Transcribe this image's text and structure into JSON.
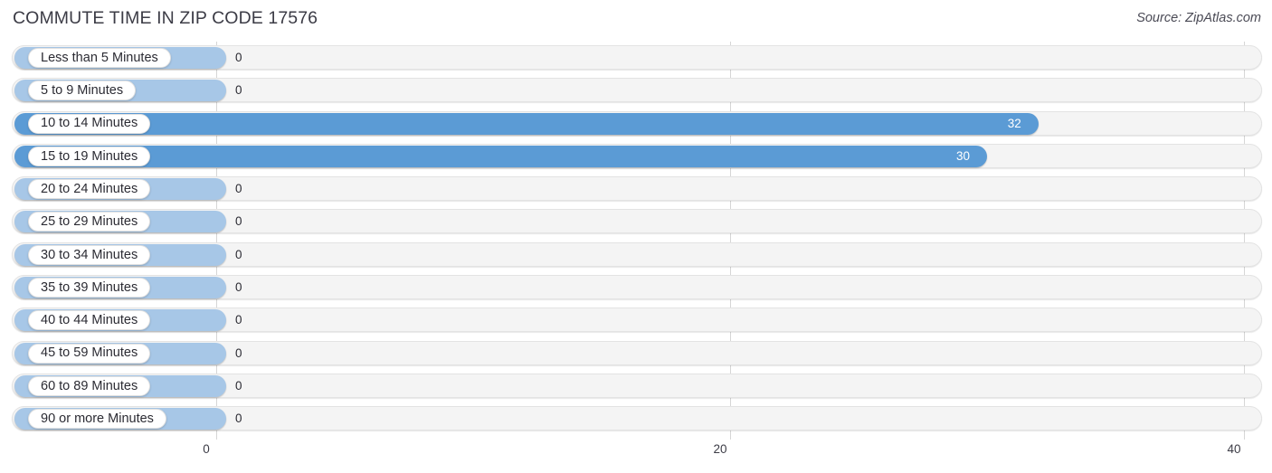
{
  "header": {
    "title": "COMMUTE TIME IN ZIP CODE 17576",
    "source": "Source: ZipAtlas.com"
  },
  "colors": {
    "bar_filled": "#5b9bd5",
    "bar_zero": "#a7c7e7",
    "track": "#f4f4f4",
    "gridline": "#d6d6d6",
    "title_text": "#3c3c46"
  },
  "chart_data": {
    "type": "bar",
    "orientation": "horizontal",
    "title": "COMMUTE TIME IN ZIP CODE 17576",
    "xlabel": "",
    "ylabel": "",
    "xlim": [
      0,
      40
    ],
    "grid": true,
    "legend": false,
    "xticks": [
      "0",
      "20",
      "40"
    ],
    "xtick_values": [
      0,
      20,
      40
    ],
    "categories": [
      "Less than 5 Minutes",
      "5 to 9 Minutes",
      "10 to 14 Minutes",
      "15 to 19 Minutes",
      "20 to 24 Minutes",
      "25 to 29 Minutes",
      "30 to 34 Minutes",
      "35 to 39 Minutes",
      "40 to 44 Minutes",
      "45 to 59 Minutes",
      "60 to 89 Minutes",
      "90 or more Minutes"
    ],
    "values": [
      0,
      0,
      32,
      30,
      0,
      0,
      0,
      0,
      0,
      0,
      0,
      0
    ],
    "value_labels": [
      "0",
      "0",
      "32",
      "30",
      "0",
      "0",
      "0",
      "0",
      "0",
      "0",
      "0",
      "0"
    ]
  },
  "rows": [
    {
      "label": "Less than 5 Minutes",
      "value": 0,
      "value_label": "0"
    },
    {
      "label": "5 to 9 Minutes",
      "value": 0,
      "value_label": "0"
    },
    {
      "label": "10 to 14 Minutes",
      "value": 32,
      "value_label": "32"
    },
    {
      "label": "15 to 19 Minutes",
      "value": 30,
      "value_label": "30"
    },
    {
      "label": "20 to 24 Minutes",
      "value": 0,
      "value_label": "0"
    },
    {
      "label": "25 to 29 Minutes",
      "value": 0,
      "value_label": "0"
    },
    {
      "label": "30 to 34 Minutes",
      "value": 0,
      "value_label": "0"
    },
    {
      "label": "35 to 39 Minutes",
      "value": 0,
      "value_label": "0"
    },
    {
      "label": "40 to 44 Minutes",
      "value": 0,
      "value_label": "0"
    },
    {
      "label": "45 to 59 Minutes",
      "value": 0,
      "value_label": "0"
    },
    {
      "label": "60 to 89 Minutes",
      "value": 0,
      "value_label": "0"
    },
    {
      "label": "90 or more Minutes",
      "value": 0,
      "value_label": "0"
    }
  ],
  "axis": {
    "ticks": [
      {
        "label": "0"
      },
      {
        "label": "20"
      },
      {
        "label": "40"
      }
    ]
  }
}
